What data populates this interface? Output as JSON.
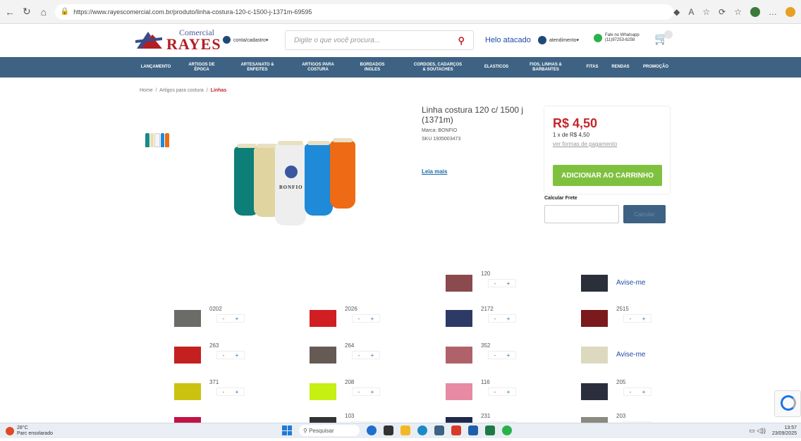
{
  "browser": {
    "url": "https://www.rayescomercial.com.br/produto/linha-costura-120-c-1500-j-1371m-69595"
  },
  "header": {
    "logo_top": "Comercial",
    "logo_main": "RAYES",
    "account_label": "conta/cadastro▾",
    "search_placeholder": "Digite o que você procura...",
    "helo": "Helo atacado",
    "atendimento": "atendimento▾",
    "whatsapp_line1": "Fale no Whatsapp",
    "whatsapp_line2": "(11)97253-8258"
  },
  "nav": [
    {
      "label": "LANÇAMENTO"
    },
    {
      "label": "ARTIGOS DE ÉPOCA"
    },
    {
      "label": "ARTESANATO & ENFEITES"
    },
    {
      "label": "ARTIGOS PARA COSTURA"
    },
    {
      "label": "BORDADOS INGLES"
    },
    {
      "label": "CORDOES, CADARÇOS & SOUTACHES"
    },
    {
      "label": "ELASTICOS"
    },
    {
      "label": "FIOS, LINHAS & BARBANTES"
    },
    {
      "label": "FITAS"
    },
    {
      "label": "RENDAS"
    },
    {
      "label": "PROMOÇÃO"
    }
  ],
  "breadcrumb": {
    "home": "Home",
    "sep": "/",
    "cat": "Artigos para costura",
    "current": "Linhas"
  },
  "product": {
    "title": "Linha costura 120 c/ 1500 j (1371m)",
    "brand": "Marca: BONFIO",
    "sku": "SKU 1935003473",
    "leia_mais": "Leia mais",
    "spool_brand": "BONFIO",
    "price": "R$ 4,50",
    "installments": "1 x de R$ 4,50",
    "payment_link": "ver formas de pagamento",
    "add_to_cart": "ADICIONAR AO CARRINHO",
    "freight_label": "Calcular Frete",
    "calc_button": "Calcular"
  },
  "stepper": {
    "minus": "-",
    "plus": "+"
  },
  "variants": [
    {
      "code": "120",
      "color": "#8a4a4e",
      "avise": false
    },
    {
      "code": "",
      "color": "#2a2f3a",
      "avise": true,
      "avise_label": "Avise-me"
    },
    {
      "code": "0202",
      "color": "#6b6b68",
      "avise": false
    },
    {
      "code": "2026",
      "color": "#d01e22",
      "avise": false
    },
    {
      "code": "2172",
      "color": "#2e3a66",
      "avise": false
    },
    {
      "code": "2515",
      "color": "#7a1a1c",
      "avise": false
    },
    {
      "code": "263",
      "color": "#c4201f",
      "avise": false
    },
    {
      "code": "264",
      "color": "#665a55",
      "avise": false
    },
    {
      "code": "352",
      "color": "#b0626a",
      "avise": false
    },
    {
      "code": "",
      "color": "#ddd9bf",
      "avise": true,
      "avise_label": "Avise-me"
    },
    {
      "code": "371",
      "color": "#cbc20f",
      "avise": false
    },
    {
      "code": "208",
      "color": "#c6ef12",
      "avise": false
    },
    {
      "code": "116",
      "color": "#e78aa4",
      "avise": false
    },
    {
      "code": "205",
      "color": "#2b2f3d",
      "avise": false
    },
    {
      "code": "",
      "color": "#c21444",
      "avise": false
    },
    {
      "code": "103",
      "color": "#333",
      "avise": false
    },
    {
      "code": "231",
      "color": "#1f2a4a",
      "avise": false
    },
    {
      "code": "203",
      "color": "#8a8a80",
      "avise": false
    }
  ],
  "taskbar": {
    "temp": "28°C",
    "weather": "Parc ensolarado",
    "search": "Pesquisar",
    "time": "13:57",
    "date": "23/09/2025"
  }
}
